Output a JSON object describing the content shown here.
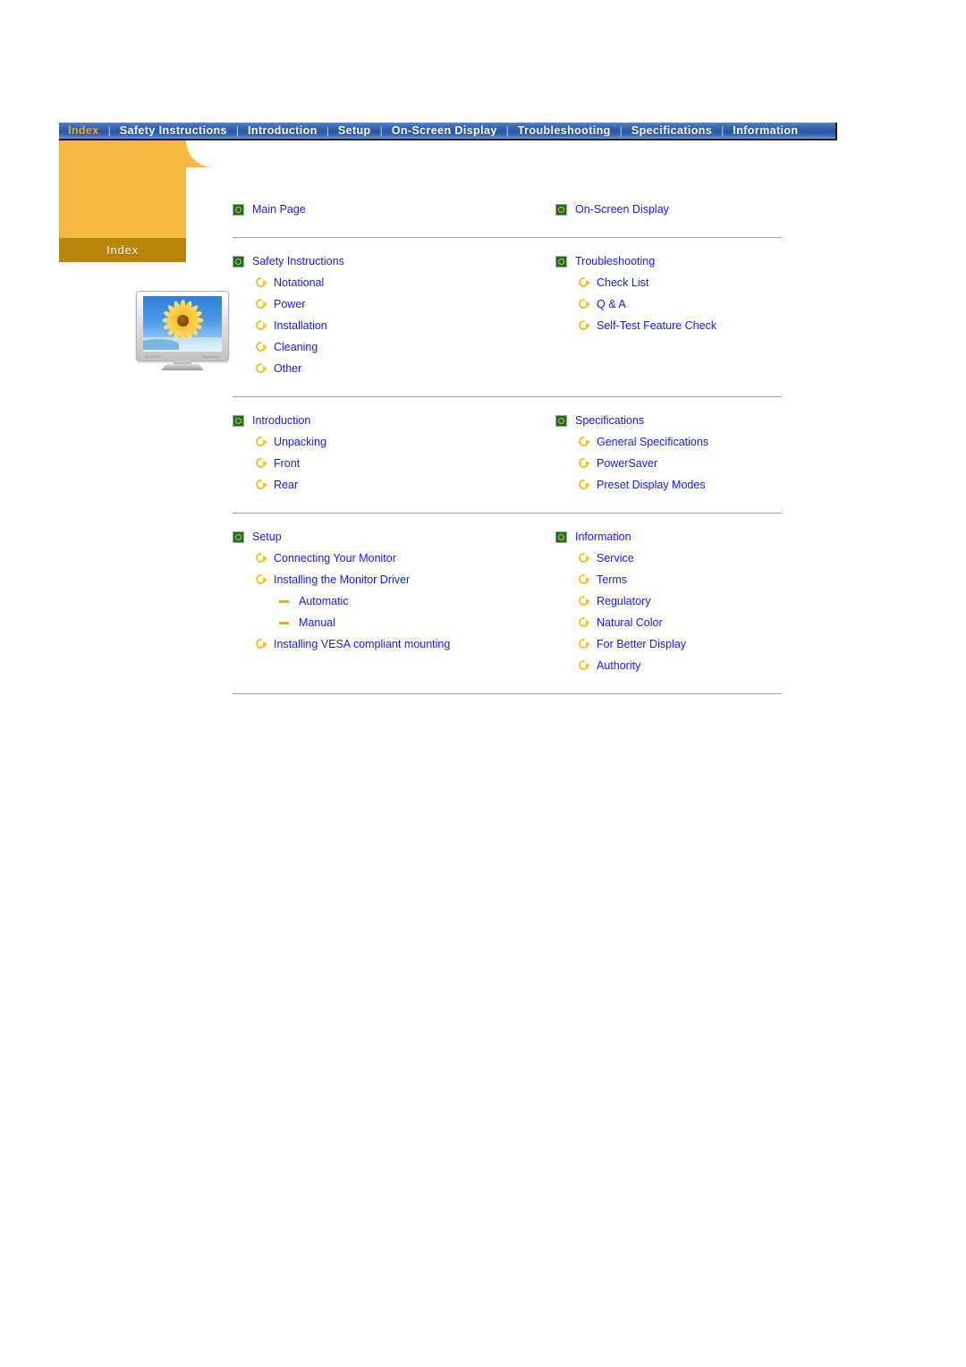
{
  "navbar": {
    "items": [
      {
        "label": "Index",
        "active": true
      },
      {
        "label": "Safety Instructions",
        "active": false
      },
      {
        "label": "Introduction",
        "active": false
      },
      {
        "label": "Setup",
        "active": false
      },
      {
        "label": "On-Screen Display",
        "active": false
      },
      {
        "label": "Troubleshooting",
        "active": false
      },
      {
        "label": "Specifications",
        "active": false
      },
      {
        "label": "Information",
        "active": false
      }
    ],
    "separator": "|",
    "active_color": "#f5a623",
    "text_color": "#ffffff",
    "background_color": "#2d5aa8"
  },
  "sidepanel": {
    "band_label": "Index",
    "panel_color": "#f5b942",
    "band_color": "#b8860b",
    "monitor": {
      "brand_text": "SAMSUNG",
      "model_text": "SyncMaster"
    }
  },
  "content": {
    "link_color": "#1a1aee",
    "groups": [
      {
        "left": [
          {
            "level": 1,
            "icon": "green-square-icon",
            "label": "Main Page"
          }
        ],
        "right": [
          {
            "level": 1,
            "icon": "green-square-icon",
            "label": "On-Screen Display"
          }
        ]
      },
      {
        "left": [
          {
            "level": 1,
            "icon": "green-square-icon",
            "label": "Safety Instructions"
          },
          {
            "level": 2,
            "icon": "yellow-arrow-icon",
            "label": "Notational"
          },
          {
            "level": 2,
            "icon": "yellow-arrow-icon",
            "label": "Power"
          },
          {
            "level": 2,
            "icon": "yellow-arrow-icon",
            "label": "Installation"
          },
          {
            "level": 2,
            "icon": "yellow-arrow-icon",
            "label": "Cleaning"
          },
          {
            "level": 2,
            "icon": "yellow-arrow-icon",
            "label": "Other"
          }
        ],
        "right": [
          {
            "level": 1,
            "icon": "green-square-icon",
            "label": "Troubleshooting"
          },
          {
            "level": 2,
            "icon": "yellow-arrow-icon",
            "label": "Check List"
          },
          {
            "level": 2,
            "icon": "yellow-arrow-icon",
            "label": "Q & A"
          },
          {
            "level": 2,
            "icon": "yellow-arrow-icon",
            "label": "Self-Test Feature Check"
          }
        ]
      },
      {
        "left": [
          {
            "level": 1,
            "icon": "green-square-icon",
            "label": "Introduction"
          },
          {
            "level": 2,
            "icon": "yellow-arrow-icon",
            "label": "Unpacking"
          },
          {
            "level": 2,
            "icon": "yellow-arrow-icon",
            "label": "Front"
          },
          {
            "level": 2,
            "icon": "yellow-arrow-icon",
            "label": "Rear"
          }
        ],
        "right": [
          {
            "level": 1,
            "icon": "green-square-icon",
            "label": "Specifications"
          },
          {
            "level": 2,
            "icon": "yellow-arrow-icon",
            "label": "General Specifications"
          },
          {
            "level": 2,
            "icon": "yellow-arrow-icon",
            "label": "PowerSaver"
          },
          {
            "level": 2,
            "icon": "yellow-arrow-icon",
            "label": "Preset Display Modes"
          }
        ]
      },
      {
        "left": [
          {
            "level": 1,
            "icon": "green-square-icon",
            "label": "Setup"
          },
          {
            "level": 2,
            "icon": "yellow-arrow-icon",
            "label": "Connecting Your Monitor"
          },
          {
            "level": 2,
            "icon": "yellow-arrow-icon",
            "label": "Installing the Monitor Driver"
          },
          {
            "level": 3,
            "icon": "orange-dash-icon",
            "label": "Automatic"
          },
          {
            "level": 3,
            "icon": "orange-dash-icon",
            "label": "Manual"
          },
          {
            "level": 2,
            "icon": "yellow-arrow-icon",
            "label": "Installing VESA compliant mounting"
          }
        ],
        "right": [
          {
            "level": 1,
            "icon": "green-square-icon",
            "label": "Information"
          },
          {
            "level": 2,
            "icon": "yellow-arrow-icon",
            "label": "Service"
          },
          {
            "level": 2,
            "icon": "yellow-arrow-icon",
            "label": "Terms"
          },
          {
            "level": 2,
            "icon": "yellow-arrow-icon",
            "label": "Regulatory"
          },
          {
            "level": 2,
            "icon": "yellow-arrow-icon",
            "label": "Natural Color"
          },
          {
            "level": 2,
            "icon": "yellow-arrow-icon",
            "label": "For Better Display"
          },
          {
            "level": 2,
            "icon": "yellow-arrow-icon",
            "label": "Authority"
          }
        ]
      }
    ]
  }
}
